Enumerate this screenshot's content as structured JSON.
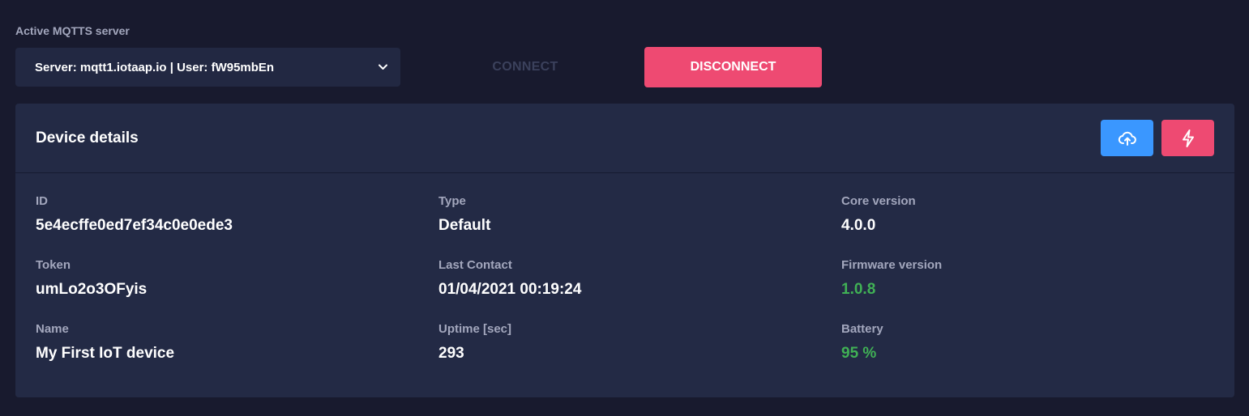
{
  "server": {
    "label": "Active MQTTS server",
    "selected": "Server: mqtt1.iotaap.io | User: fW95mbEn"
  },
  "actions": {
    "connect_label": "CONNECT",
    "disconnect_label": "DISCONNECT"
  },
  "card": {
    "title": "Device details",
    "upload_icon": "cloud-upload-icon",
    "flash_icon": "lightning-icon"
  },
  "fields": {
    "id": {
      "label": "ID",
      "value": "5e4ecffe0ed7ef34c0e0ede3"
    },
    "token": {
      "label": "Token",
      "value": "umLo2o3OFyis"
    },
    "name": {
      "label": "Name",
      "value": "My First IoT device"
    },
    "type": {
      "label": "Type",
      "value": "Default"
    },
    "last_contact": {
      "label": "Last Contact",
      "value": "01/04/2021 00:19:24"
    },
    "uptime": {
      "label": "Uptime [sec]",
      "value": "293"
    },
    "core_version": {
      "label": "Core version",
      "value": "4.0.0"
    },
    "firmware_version": {
      "label": "Firmware version",
      "value": "1.0.8"
    },
    "battery": {
      "label": "Battery",
      "value": "95 %"
    }
  },
  "colors": {
    "background": "#181a2e",
    "card": "#232a45",
    "accent_red": "#ee4a72",
    "accent_blue": "#3a97ff",
    "success_green": "#40b155"
  }
}
